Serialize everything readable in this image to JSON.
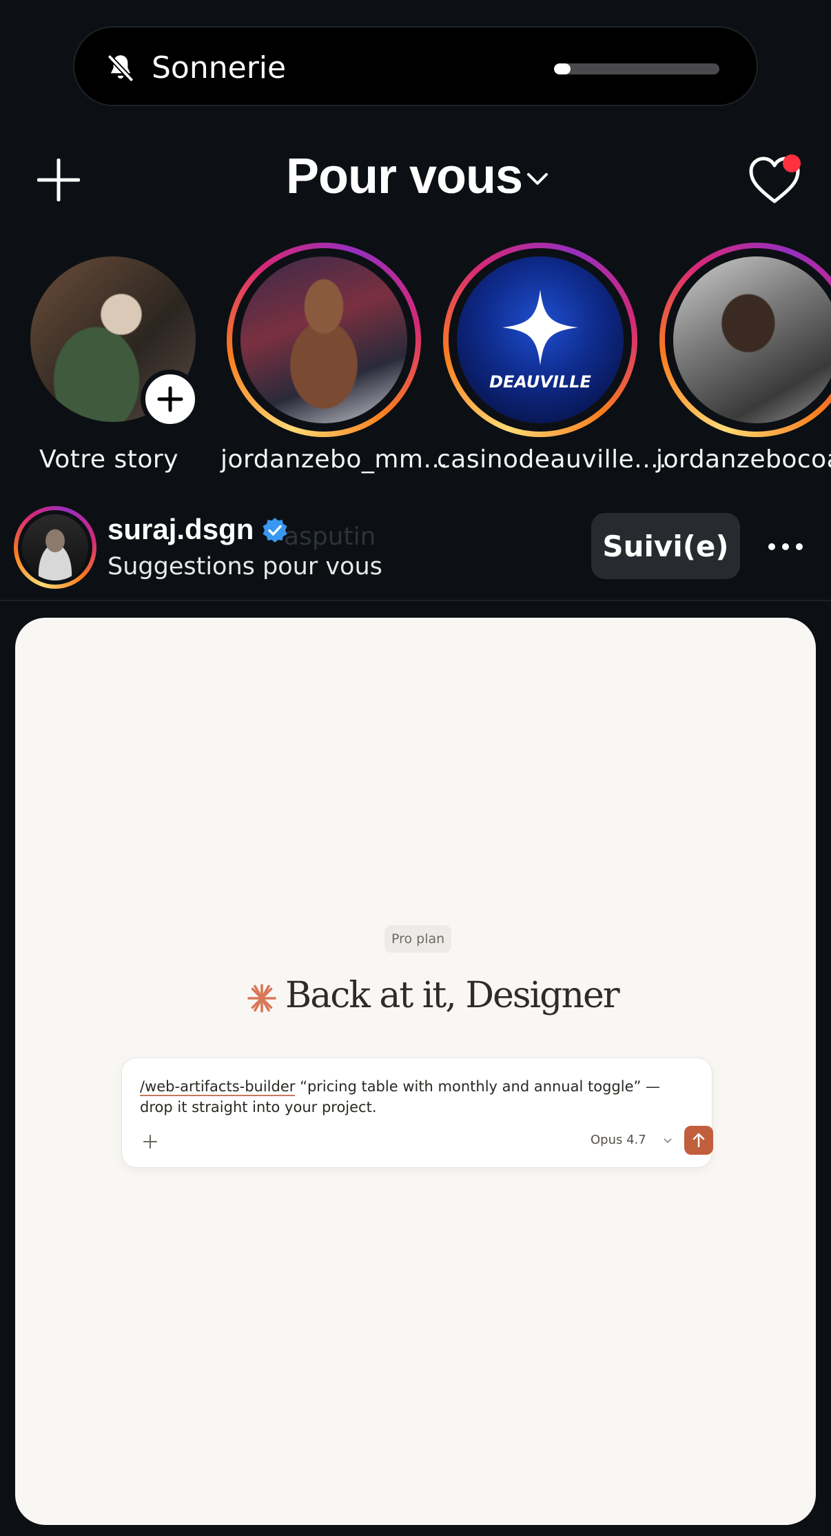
{
  "ringer": {
    "label": "Sonnerie",
    "icon": "bell-slash-icon",
    "volume_level": 0.1
  },
  "header": {
    "title": "Pour vous",
    "add_icon": "plus-icon",
    "activity_icon": "heart-icon",
    "has_notification": true,
    "notification_color": "#ff3040"
  },
  "stories": [
    {
      "username": "Votre story",
      "own": true
    },
    {
      "username": "jordanzebo_mm..."
    },
    {
      "username": "casinodeauville....",
      "logo_text": "DEAUVILLE"
    },
    {
      "username": "jordanzebocoac"
    }
  ],
  "post": {
    "username": "suraj.dsgn",
    "verified": true,
    "overlap_text": "asputin",
    "subtitle": "Suggestions pour vous",
    "follow_label": "Suivi(e)",
    "more_icon": "more-horizontal-icon",
    "card": {
      "plan_badge": "Pro plan",
      "greeting": "Back at it, Designer",
      "prompt_command": "/web-artifacts-builder",
      "prompt_rest": " “pricing table with monthly and annual toggle” — drop it straight into your project.",
      "model_label": "Opus 4.7",
      "accent_color": "#c15f3c"
    }
  }
}
